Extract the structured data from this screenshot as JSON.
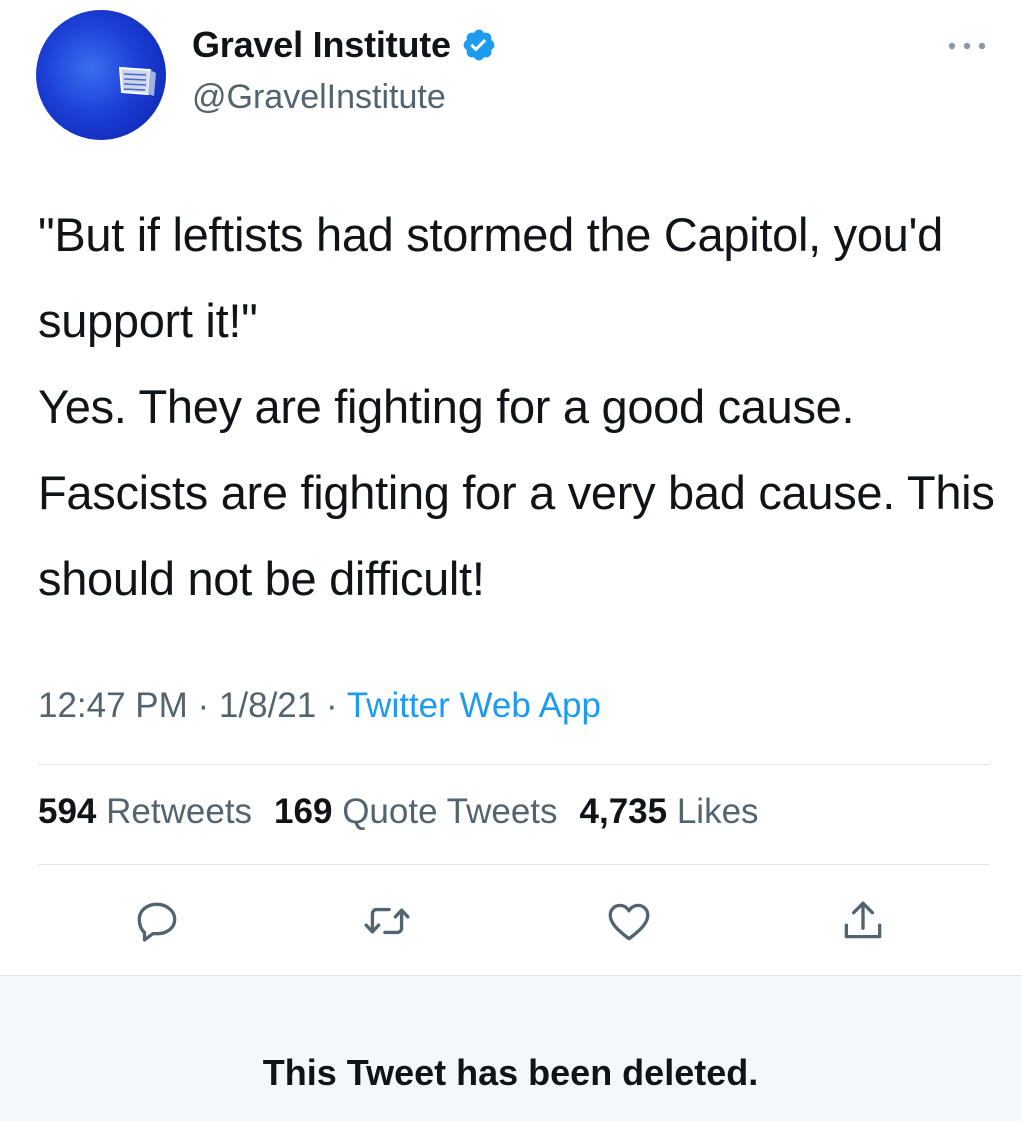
{
  "author": {
    "name": "Gravel Institute",
    "handle": "@GravelInstitute",
    "verified_icon": "verified-badge-icon",
    "avatar_icon": "gravel-institute-logo",
    "accent": "#1d9bf0"
  },
  "tweet": {
    "paragraphs": [
      "\"But if leftists had stormed the Capitol, you'd support it!\"",
      "Yes. They are fighting for a good cause. Fascists are fighting for a very bad cause. This should not be difficult!"
    ],
    "time": "12:47 PM",
    "date": "1/8/21",
    "separator": " · ",
    "source": "Twitter Web App"
  },
  "stats": {
    "retweets_count": "594",
    "retweets_label": "Retweets",
    "quotes_count": "169",
    "quotes_label": "Quote Tweets",
    "likes_count": "4,735",
    "likes_label": "Likes"
  },
  "actions": [
    "reply-icon",
    "retweet-icon",
    "like-icon",
    "share-icon"
  ],
  "deleted_notice": "This Tweet has been deleted."
}
